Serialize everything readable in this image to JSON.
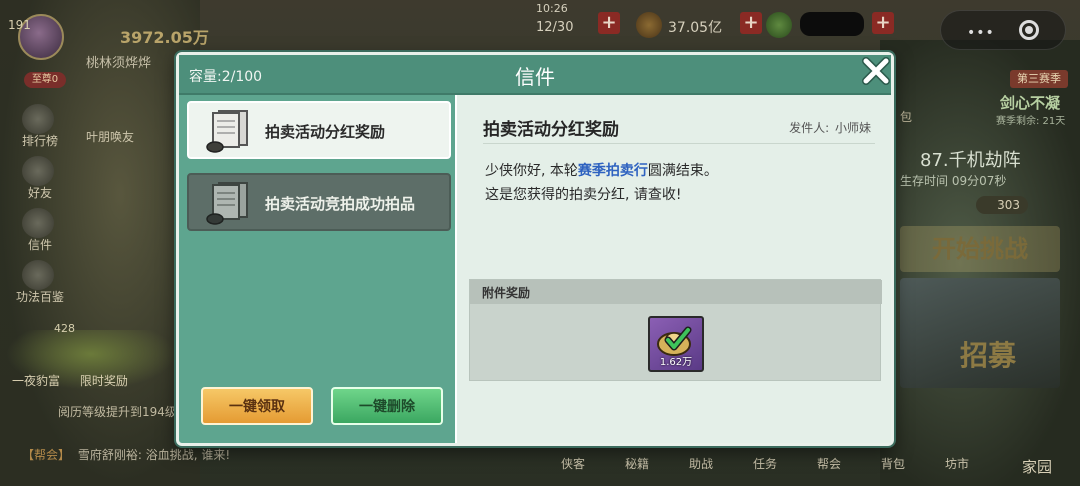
{
  "game_hud": {
    "level": "191",
    "gold": "3972.05万",
    "player_name": "桃林须烨烨",
    "rank": "至尊0",
    "clock": "10:26",
    "stamina": "12/30",
    "copper": "37.05亿",
    "side_menu": [
      "排行榜",
      "好友",
      "信件",
      "功法百鉴"
    ],
    "side_menu_extra": [
      "叶朋唤友"
    ],
    "frog_labels": [
      "一夜豹富",
      "限时奖励"
    ],
    "frog_count": "428",
    "progress_hint": "阅历等级提升到194级",
    "chat_guild": "【帮会】",
    "chat_text": "雪府舒刚裕: 浴血挑战, 谁来!",
    "bottom_nav": [
      "侠客",
      "秘籍",
      "助战",
      "任务",
      "帮会",
      "背包",
      "坊市"
    ],
    "home": "家园",
    "bag": "包",
    "season_badge": "第三赛季",
    "season_title": "剑心不凝",
    "season_remain": "赛季剩余: 21天",
    "stage_title": "87.千机劫阵",
    "stage_time": "生存时间  09分07秒",
    "stage_power": "303",
    "challenge": "开始挑战",
    "recruit": "招募"
  },
  "mail_dialog": {
    "title": "信件",
    "capacity": "容量:2/100",
    "mails": [
      {
        "subject": "拍卖活动分红奖励",
        "active": true
      },
      {
        "subject": "拍卖活动竞拍成功拍品",
        "active": false
      }
    ],
    "buttons": {
      "collect_all": "一键领取",
      "delete_all": "一键删除"
    },
    "detail": {
      "subject": "拍卖活动分红奖励",
      "sender_label": "发件人:",
      "sender_name": "小师妹",
      "body_prefix": "少侠你好, 本轮",
      "body_highlight": "赛季拍卖行",
      "body_suffix": "圆满结束。",
      "body_line2": "这是您获得的拍卖分红, 请查收!",
      "attachments_label": "附件奖励",
      "reward_amount": "1.62万"
    }
  },
  "colors": {
    "dialog_bg": "#5ea58f",
    "content_bg": "#e4efe8",
    "highlight": "#2e62c0",
    "collect_btn": "#f0b44c",
    "delete_btn": "#4fbd72"
  }
}
